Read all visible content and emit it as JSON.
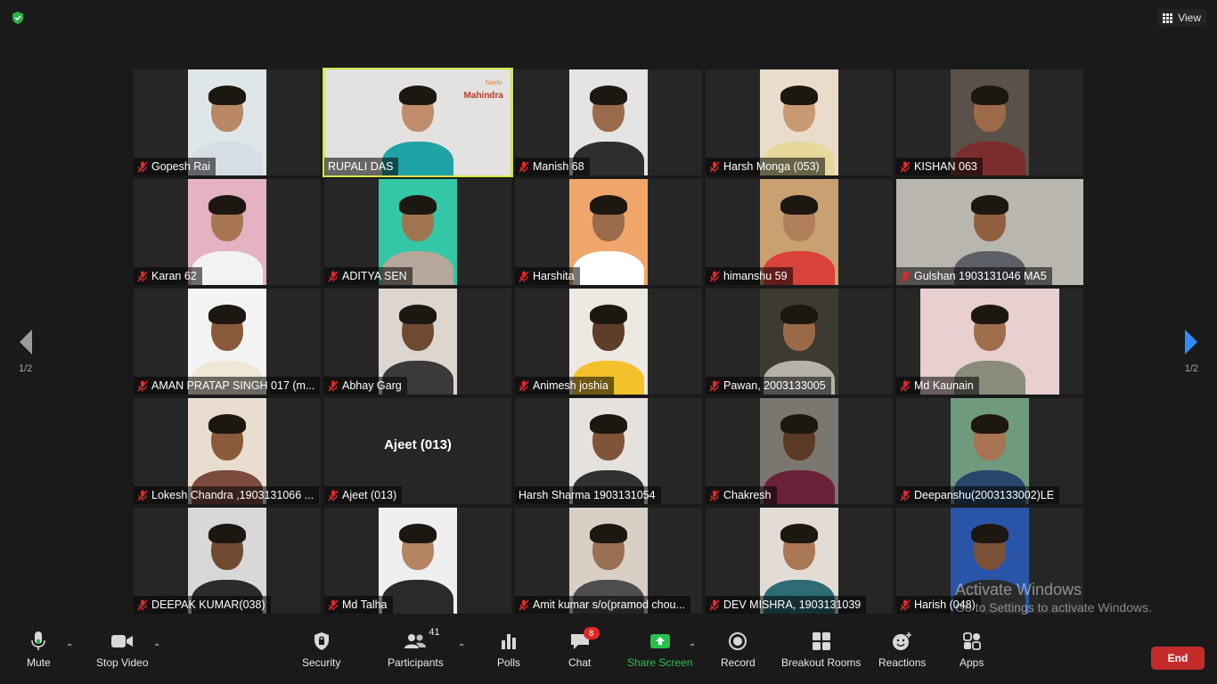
{
  "topbar": {
    "view_label": "View"
  },
  "pagination": {
    "left": "1/2",
    "right": "1/2"
  },
  "participants_grid": [
    {
      "name": "Gopesh Rai",
      "muted": true,
      "skin": "#b98763",
      "bg": "#dfe6ea",
      "shirt": "#d7dde4",
      "video": "narrow"
    },
    {
      "name": "RUPALI DAS",
      "muted": false,
      "skin": "#c08c6c",
      "bg": "#e3e2e0",
      "shirt": "#1fa3a6",
      "video": "wide",
      "active": true,
      "logo": "Mahindra",
      "logo_sub": "Nanhi"
    },
    {
      "name": "Manish 68",
      "muted": true,
      "skin": "#9a6b4b",
      "bg": "#e4e4e4",
      "shirt": "#2e2e2e",
      "video": "narrow"
    },
    {
      "name": "Harsh Monga (053)",
      "muted": true,
      "skin": "#c79a74",
      "bg": "#eadccb",
      "shirt": "#e6d99b",
      "video": "narrow"
    },
    {
      "name": "KISHAN 063",
      "muted": true,
      "skin": "#9c6a46",
      "bg": "#5a5149",
      "shirt": "#7b2d2d",
      "video": "narrow"
    },
    {
      "name": "Karan 62",
      "muted": true,
      "skin": "#a87653",
      "bg": "#e3b2c3",
      "shirt": "#f2f2f2",
      "video": "narrow"
    },
    {
      "name": "ADITYA SEN",
      "muted": true,
      "skin": "#a0744f",
      "bg": "#33c7a5",
      "shirt": "#b6a79a",
      "video": "narrow"
    },
    {
      "name": "Harshita",
      "muted": true,
      "skin": "#9a6a4a",
      "bg": "#f0a66a",
      "shirt": "#ffffff",
      "video": "narrow"
    },
    {
      "name": "himanshu 59",
      "muted": true,
      "skin": "#b1805a",
      "bg": "#c9a070",
      "shirt": "#d9413b",
      "video": "narrow"
    },
    {
      "name": "Gulshan 1903131046 MA5",
      "muted": true,
      "skin": "#8f5f40",
      "bg": "#b9b6b0",
      "shirt": "#5c5f66",
      "video": "full"
    },
    {
      "name": "AMAN PRATAP SINGH 017 (m...",
      "muted": true,
      "skin": "#8a5a3a",
      "bg": "#f4f4f4",
      "shirt": "#f0e6d6",
      "video": "narrow"
    },
    {
      "name": "Abhay Garg",
      "muted": true,
      "skin": "#6e4a32",
      "bg": "#dcd6cf",
      "shirt": "#3b3a38",
      "video": "narrow"
    },
    {
      "name": "Animesh joshia",
      "muted": true,
      "skin": "#5e3e2a",
      "bg": "#eee8e2",
      "shirt": "#f3c12b",
      "video": "narrow"
    },
    {
      "name": "Pawan,  2003133005",
      "muted": true,
      "skin": "#9a6a48",
      "bg": "#3d3a32",
      "shirt": "#b7b2a9",
      "video": "narrow"
    },
    {
      "name": "Md Kaunain",
      "muted": true,
      "skin": "#9e6e4b",
      "bg": "#e8cfd0",
      "shirt": "#8b8b7a",
      "video": "mid"
    },
    {
      "name": "Lokesh Chandra ,1903131066 ...",
      "muted": true,
      "skin": "#8a5a3a",
      "bg": "#e9ddd0",
      "shirt": "#7a4a3c",
      "video": "narrow"
    },
    {
      "name": "Ajeet (013)",
      "muted": true,
      "audio_only": true,
      "display": "Ajeet (013)"
    },
    {
      "name": "Harsh Sharma 1903131054",
      "muted": false,
      "skin": "#805438",
      "bg": "#e5e1dc",
      "shirt": "#313131",
      "video": "narrow"
    },
    {
      "name": "Chakresh",
      "muted": true,
      "skin": "#5a3a26",
      "bg": "#7a7670",
      "shirt": "#6a2238",
      "video": "narrow"
    },
    {
      "name": "Deepanshu(2003133002)LE",
      "muted": true,
      "skin": "#a77352",
      "bg": "#6f9a7d",
      "shirt": "#27476a",
      "video": "narrow"
    },
    {
      "name": "DEEPAK KUMAR(038)",
      "muted": true,
      "skin": "#704a30",
      "bg": "#d8d8d8",
      "shirt": "#2b2b2b",
      "video": "narrow"
    },
    {
      "name": "Md Talha",
      "muted": true,
      "skin": "#b48463",
      "bg": "#efefef",
      "shirt": "#2a2a2a",
      "video": "narrow"
    },
    {
      "name": "Amit kumar s/o(pramod chou...",
      "muted": true,
      "skin": "#9a7052",
      "bg": "#d9cfc5",
      "shirt": "#4e4e4e",
      "video": "narrow"
    },
    {
      "name": "DEV MISHRA, 1903131039",
      "muted": true,
      "skin": "#aa7755",
      "bg": "#e3dcd5",
      "shirt": "#2e6b74",
      "video": "narrow"
    },
    {
      "name": "Harish (048)",
      "muted": true,
      "skin": "#7a5036",
      "bg": "#2955a8",
      "shirt": "#2a2a2a",
      "video": "narrow"
    }
  ],
  "watermark": {
    "title": "Activate Windows",
    "subtitle": "Go to Settings to activate Windows."
  },
  "toolbar": {
    "mute": "Mute",
    "stop_video": "Stop Video",
    "security": "Security",
    "participants": "Participants",
    "participants_count": "41",
    "polls": "Polls",
    "chat": "Chat",
    "chat_badge": "8",
    "share_screen": "Share Screen",
    "record": "Record",
    "breakout_rooms": "Breakout Rooms",
    "reactions": "Reactions",
    "apps": "Apps",
    "end": "End"
  },
  "colors": {
    "active_speaker": "#d7e54a",
    "share_green": "#27c24c",
    "end_red": "#c62b2b",
    "muted_red": "#e02828"
  }
}
